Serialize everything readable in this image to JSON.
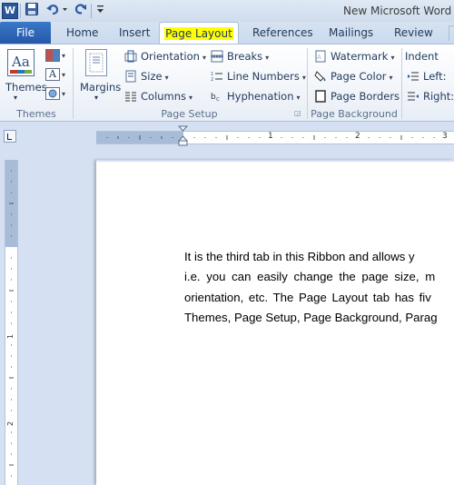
{
  "window": {
    "title": "New Microsoft Word D",
    "app_logo_letter": "W"
  },
  "tabs": {
    "file": "File",
    "home": "Home",
    "insert": "Insert",
    "page_layout": "Page Layout",
    "references": "References",
    "mailings": "Mailings",
    "review": "Review"
  },
  "ribbon": {
    "themes": {
      "button_label": "Themes",
      "group_label": "Themes",
      "fonts_glyph": "A"
    },
    "page_setup": {
      "margins_label": "Margins",
      "orientation": "Orientation",
      "size": "Size",
      "columns": "Columns",
      "breaks": "Breaks",
      "line_numbers": "Line Numbers",
      "hyphenation": "Hyphenation",
      "group_label": "Page Setup"
    },
    "page_background": {
      "watermark": "Watermark",
      "page_color": "Page Color",
      "page_borders": "Page Borders",
      "group_label": "Page Background"
    },
    "paragraph": {
      "indent": "Indent",
      "left": "Left:",
      "right": "Right:"
    }
  },
  "ruler": {
    "h_numbers": [
      "1",
      "2",
      "3"
    ],
    "v_numbers": [
      "1",
      "2"
    ]
  },
  "document": {
    "lines": [
      "It is the third tab in this Ribbon and allows y",
      "i.e. you can easily change the page size, m",
      "orientation, etc. The Page Layout tab has fiv",
      "Themes, Page Setup, Page Background, Parag"
    ]
  },
  "colors": {
    "file_tab": "#2558a8",
    "highlight": "#ffff00",
    "workspace": "#d5e1f2",
    "ribbon_text": "#1e395b"
  }
}
